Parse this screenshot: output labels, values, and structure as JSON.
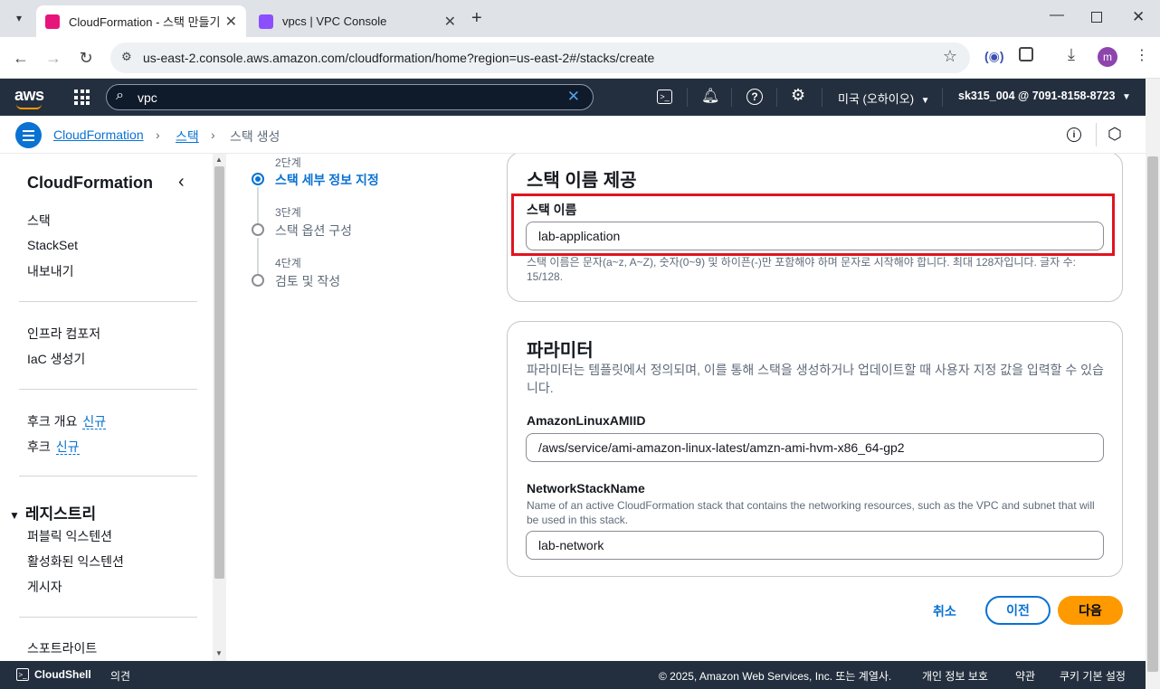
{
  "browser": {
    "tabs": [
      {
        "label": "CloudFormation - 스택 만들기",
        "active": true
      },
      {
        "label": "vpcs | VPC Console",
        "active": false
      }
    ],
    "url": "us-east-2.console.aws.amazon.com/cloudformation/home?region=us-east-2#/stacks/create",
    "profile_initial": "m"
  },
  "aws_nav": {
    "logo": "aws",
    "search_value": "vpc",
    "region": "미국 (오하이오)",
    "account": "sk315_004 @ 7091-8158-8723"
  },
  "breadcrumb": {
    "items": [
      "CloudFormation",
      "스택",
      "스택 생성"
    ]
  },
  "sidebar": {
    "title": "CloudFormation",
    "group1": [
      "스택",
      "StackSet",
      "내보내기"
    ],
    "group2": [
      "인프라 컴포저",
      "IaC 생성기"
    ],
    "group3": [
      {
        "label": "후크 개요",
        "tag": "신규"
      },
      {
        "label": "후크",
        "tag": "신규"
      }
    ],
    "registry_title": "레지스트리",
    "registry_items": [
      "퍼블릭 익스텐션",
      "활성화된 익스텐션",
      "게시자"
    ],
    "spotlight": "스포트라이트"
  },
  "steps": [
    {
      "num": "2단계",
      "label": "스택 세부 정보 지정",
      "active": true
    },
    {
      "num": "3단계",
      "label": "스택 옵션 구성",
      "active": false
    },
    {
      "num": "4단계",
      "label": "검토 및 작성",
      "active": false
    }
  ],
  "stack_name_panel": {
    "title": "스택 이름 제공",
    "field_label": "스택 이름",
    "value": "lab-application",
    "hint": "스택 이름은 문자(a~z, A~Z), 숫자(0~9) 및 하이픈(-)만 포함해야 하며 문자로 시작해야 합니다. 최대 128자입니다. 글자 수: 15/128."
  },
  "params_panel": {
    "title": "파라미터",
    "description": "파라미터는 템플릿에서 정의되며, 이를 통해 스택을 생성하거나 업데이트할 때 사용자 지정 값을 입력할 수 있습니다.",
    "params": [
      {
        "name": "AmazonLinuxAMIID",
        "description": "",
        "value": "/aws/service/ami-amazon-linux-latest/amzn-ami-hvm-x86_64-gp2"
      },
      {
        "name": "NetworkStackName",
        "description": "Name of an active CloudFormation stack that contains the networking resources, such as the VPC and subnet that will be used in this stack.",
        "value": "lab-network"
      }
    ]
  },
  "actions": {
    "cancel": "취소",
    "previous": "이전",
    "next": "다음"
  },
  "footer": {
    "cloudshell": "CloudShell",
    "feedback": "의견",
    "copyright": "© 2025, Amazon Web Services, Inc. 또는 계열사.",
    "privacy": "개인 정보 보호",
    "terms": "약관",
    "cookies": "쿠키 기본 설정"
  },
  "colors": {
    "accent": "#0972d3",
    "primary_button": "#ff9900",
    "nav_bg": "#232f3e",
    "highlight": "#e0141e"
  }
}
